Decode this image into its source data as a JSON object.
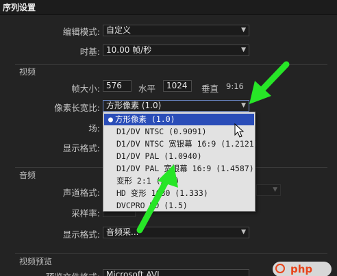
{
  "window": {
    "title": "序列设置"
  },
  "top": {
    "edit_mode_label": "编辑模式:",
    "edit_mode_value": "自定义",
    "timebase_label": "时基:",
    "timebase_value": "10.00  帧/秒"
  },
  "video": {
    "section_title": "视频",
    "frame_size_label": "帧大小:",
    "frame_width": "576",
    "horizontal_label": "水平",
    "frame_height": "1024",
    "vertical_label": "垂直",
    "aspect": "9:16",
    "pixel_aspect_label": "像素长宽比:",
    "pixel_aspect_value": "方形像素 (1.0)",
    "field_label": "场:",
    "display_format_label": "显示格式:"
  },
  "menu": {
    "items": [
      "方形像素  (1.0)",
      "D1/DV NTSC  (0.9091)",
      "D1/DV NTSC 宽银幕 16:9  (1.2121)",
      "D1/DV PAL  (1.0940)",
      "D1/DV PAL 宽银幕 16:9  (1.4587)",
      "变形 2:1  (2.0)",
      "HD 变形 1080  (1.333)",
      "DVCPRO HD  (1.5)"
    ],
    "selected_index": 0
  },
  "audio": {
    "section_title": "音频",
    "channel_format_label": "声道格式:",
    "sample_rate_label": "采样率:",
    "display_format_label": "显示格式:",
    "display_format_value": "音频采..."
  },
  "preview": {
    "section_title": "视频预览",
    "file_format_label": "预览文件格式:",
    "file_format_value": "Microsoft AVI"
  },
  "annotations": {
    "arrow_color": "#27e627",
    "watermark_text": "php"
  },
  "colors": {
    "background": "#232323",
    "menu_background": "#e2e2e2",
    "selection": "#2a4db8"
  }
}
